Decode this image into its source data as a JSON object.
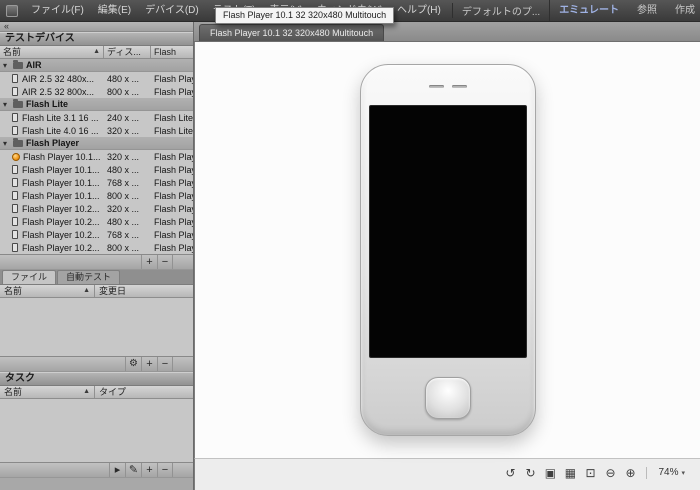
{
  "window": {
    "minimize_label": "–",
    "maximize_label": "□",
    "close_label": "×"
  },
  "menu_bar": {
    "items": [
      "ファイル(F)",
      "編集(E)",
      "デバイス(D)",
      "テスト(T)",
      "表示(V)",
      "ウィンドウ(W)",
      "ヘルプ(H)"
    ],
    "workspace": "デフォルトのプ...",
    "modes": [
      {
        "label": "エミュレート",
        "active": true
      },
      {
        "label": "参照",
        "active": false
      },
      {
        "label": "作成",
        "active": false
      }
    ],
    "accent_color": "#9fb2e4"
  },
  "tooltip": {
    "text": "Flash Player 10.1 32 320x480 Multitouch"
  },
  "main": {
    "tab_label": "Flash Player 10.1 32 320x480 Multitouch"
  },
  "sidebar": {
    "collapse_glyph": "«",
    "devices": {
      "title": "テストデバイス",
      "columns": {
        "name": "名前",
        "display": "ディス...",
        "flash": "Flash",
        "sort_glyph": "▲"
      },
      "rows": [
        {
          "type": "group",
          "name": "AIR"
        },
        {
          "type": "device",
          "name": "AIR 2.5 32 480x...",
          "display": "480 x ...",
          "flash": "Flash Play"
        },
        {
          "type": "device",
          "name": "AIR 2.5 32 800x...",
          "display": "800 x ...",
          "flash": "Flash Play"
        },
        {
          "type": "group",
          "name": "Flash Lite"
        },
        {
          "type": "device",
          "name": "Flash Lite 3.1 16 ...",
          "display": "240 x ...",
          "flash": "Flash Lite"
        },
        {
          "type": "device",
          "name": "Flash Lite 4.0 16 ...",
          "display": "320 x ...",
          "flash": "Flash Lite"
        },
        {
          "type": "group",
          "name": "Flash Player"
        },
        {
          "type": "device",
          "name": "Flash Player 10.1...",
          "display": "320 x ...",
          "flash": "Flash Play",
          "active": true
        },
        {
          "type": "device",
          "name": "Flash Player 10.1...",
          "display": "480 x ...",
          "flash": "Flash Play"
        },
        {
          "type": "device",
          "name": "Flash Player 10.1...",
          "display": "768 x ...",
          "flash": "Flash Play"
        },
        {
          "type": "device",
          "name": "Flash Player 10.1...",
          "display": "800 x ...",
          "flash": "Flash Play"
        },
        {
          "type": "device",
          "name": "Flash Player 10.2...",
          "display": "320 x ...",
          "flash": "Flash Play"
        },
        {
          "type": "device",
          "name": "Flash Player 10.2...",
          "display": "480 x ...",
          "flash": "Flash Play"
        },
        {
          "type": "device",
          "name": "Flash Player 10.2...",
          "display": "768 x ...",
          "flash": "Flash Play"
        },
        {
          "type": "device",
          "name": "Flash Player 10.2...",
          "display": "800 x ...",
          "flash": "Flash Play"
        }
      ],
      "actions": {
        "add": "+",
        "remove": "−"
      }
    },
    "files": {
      "tabs": [
        {
          "label": "ファイル",
          "active": true
        },
        {
          "label": "自動テスト",
          "active": false
        }
      ],
      "columns": {
        "name": "名前",
        "modified": "変更日",
        "sort_glyph": "▲"
      },
      "actions": {
        "settings": "⚙",
        "add": "+",
        "remove": "−"
      }
    },
    "tasks": {
      "title": "タスク",
      "columns": {
        "name": "名前",
        "type": "タイプ",
        "sort_glyph": "▲"
      },
      "actions": {
        "run": "▸",
        "edit": "✎",
        "add": "+",
        "remove": "−"
      }
    }
  },
  "status_bar": {
    "icons": [
      {
        "name": "rotate-left-icon",
        "glyph": "↺"
      },
      {
        "name": "rotate-right-icon",
        "glyph": "↻"
      },
      {
        "name": "snapshot-icon",
        "glyph": "▣"
      },
      {
        "name": "fit-window-icon",
        "glyph": "▦"
      },
      {
        "name": "actual-size-icon",
        "glyph": "⊡"
      },
      {
        "name": "zoom-out-icon",
        "glyph": "⊖"
      },
      {
        "name": "zoom-in-icon",
        "glyph": "⊕"
      }
    ],
    "zoom_level": "74%",
    "zoom_caret": "▾"
  }
}
